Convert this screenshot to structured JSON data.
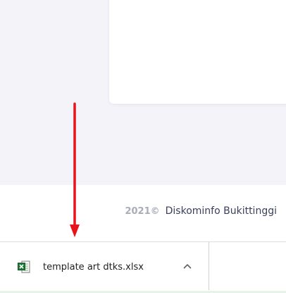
{
  "footer": {
    "year": "2021©",
    "company": "Diskominfo Bukittinggi"
  },
  "download": {
    "filename": "template art dtks.xlsx",
    "file_icon": "excel-file-icon",
    "menu_icon": "chevron-up-icon"
  },
  "annotation": {
    "arrow_color": "#e8141b"
  }
}
